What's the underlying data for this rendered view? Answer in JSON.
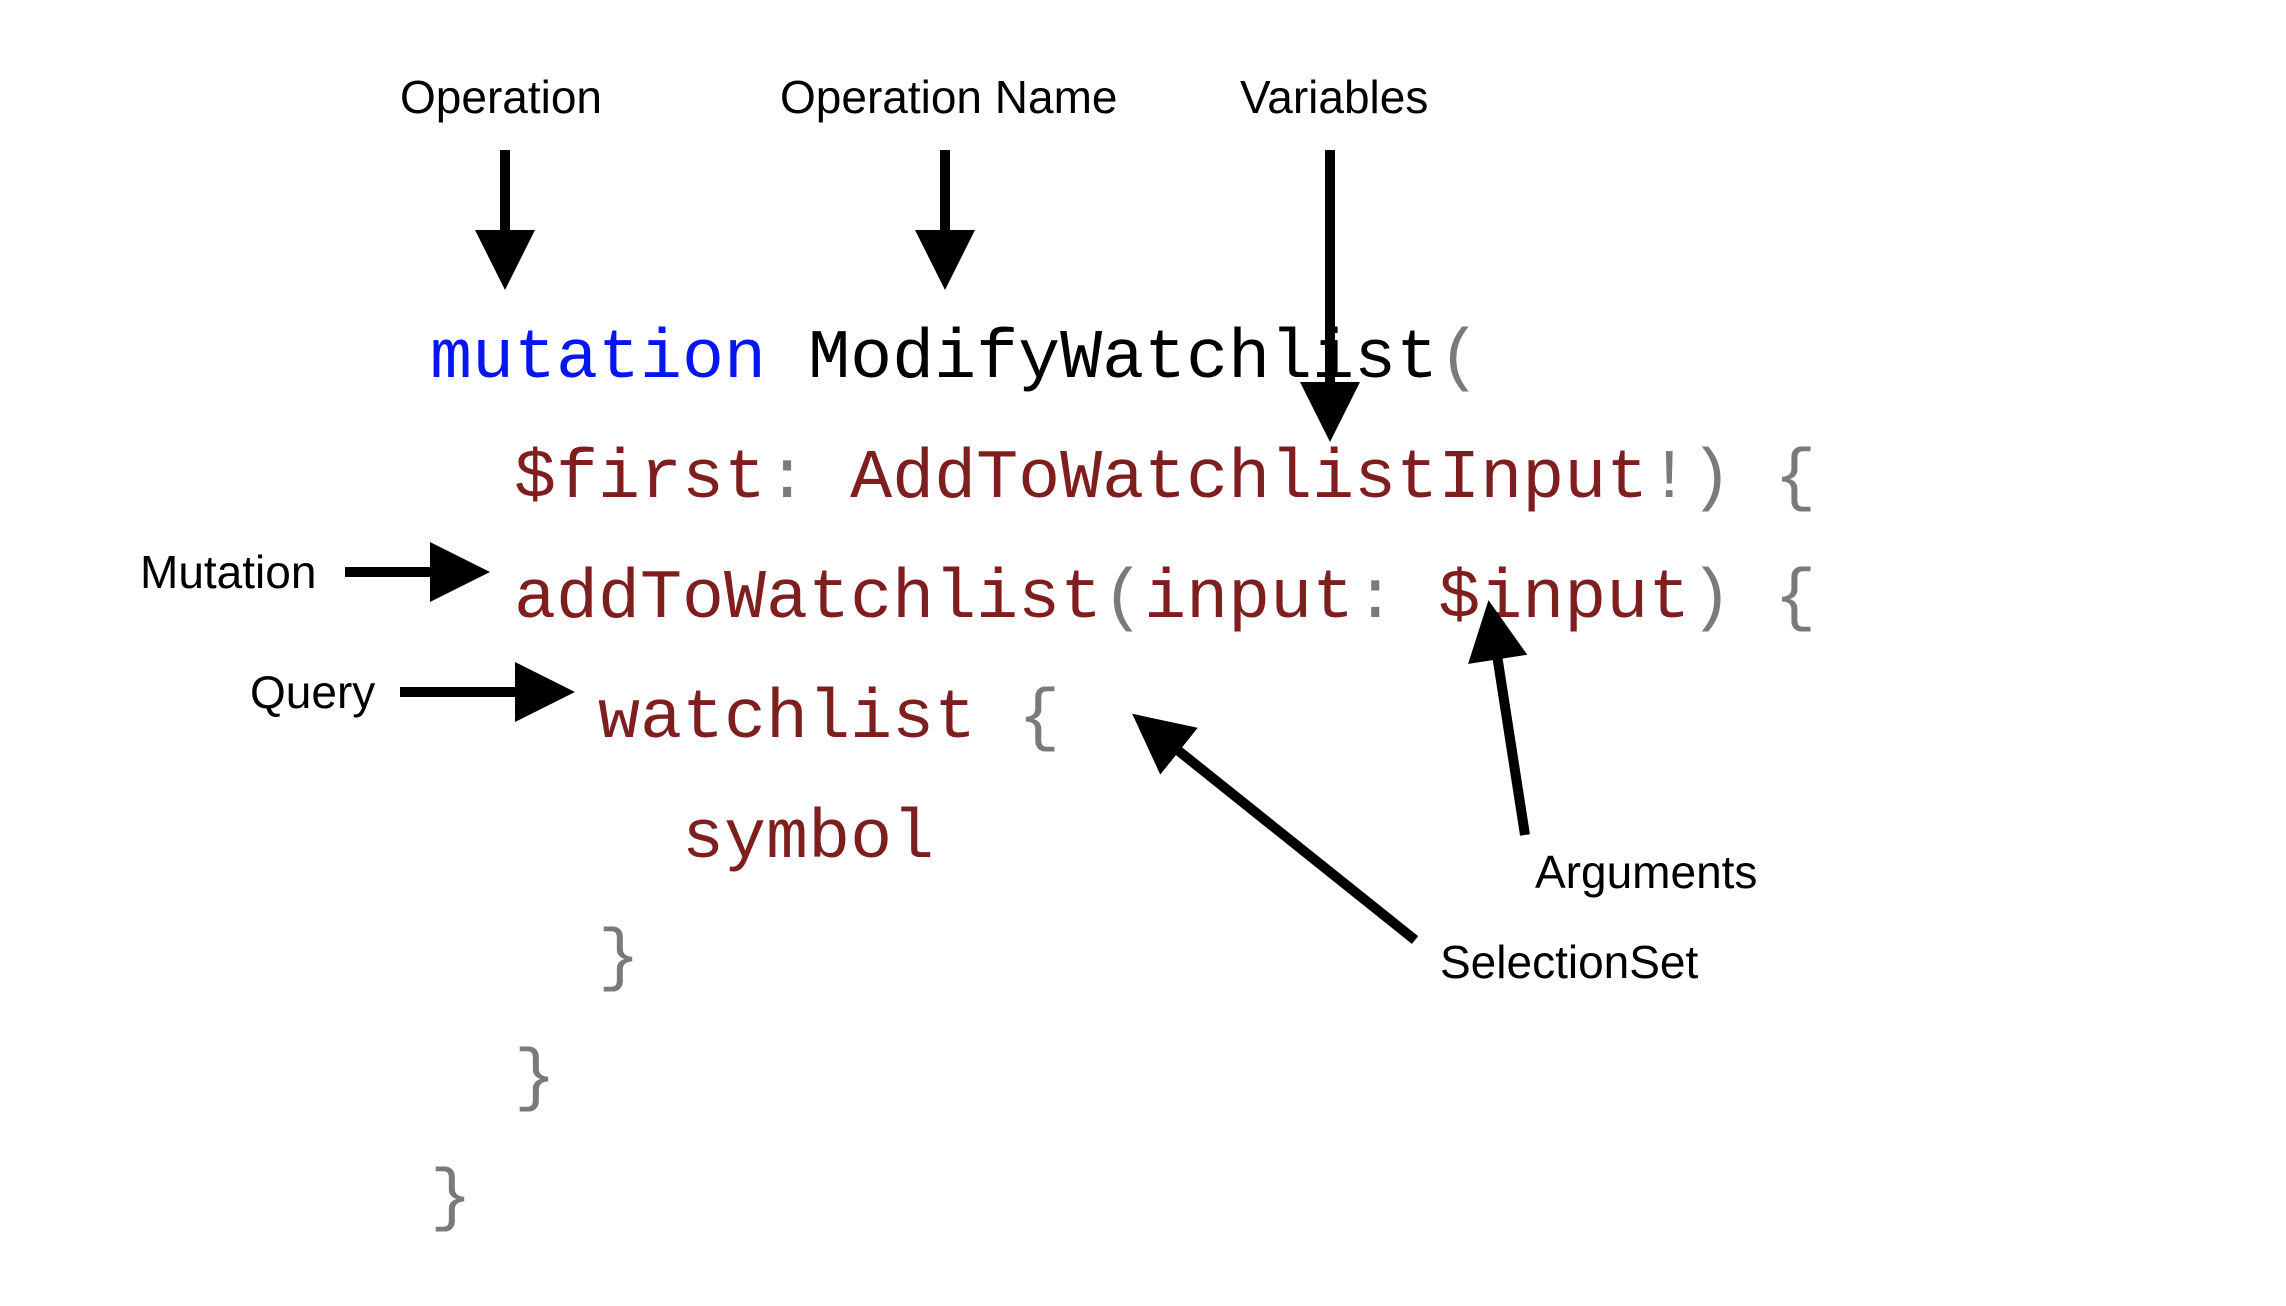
{
  "labels": {
    "operation": "Operation",
    "operation_name": "Operation Name",
    "variables": "Variables",
    "mutation": "Mutation",
    "query": "Query",
    "selection_set": "SelectionSet",
    "arguments": "Arguments"
  },
  "code": {
    "keyword_mutation": "mutation",
    "op_name": "ModifyWatchlist",
    "paren_open": "(",
    "var_name": "$first",
    "colon1": ":",
    "var_type": "AddToWatchlistInput",
    "bang": "!",
    "paren_close": ")",
    "brace_open1": "{",
    "field_addToWatchlist": "addToWatchlist",
    "paren_open2": "(",
    "arg_name": "input",
    "colon2": ":",
    "arg_value": "$input",
    "paren_close2": ")",
    "brace_open2": "{",
    "field_watchlist": "watchlist",
    "brace_open3": "{",
    "field_symbol": "symbol",
    "brace_close3": "}",
    "brace_close2": "}",
    "brace_close1": "}"
  }
}
